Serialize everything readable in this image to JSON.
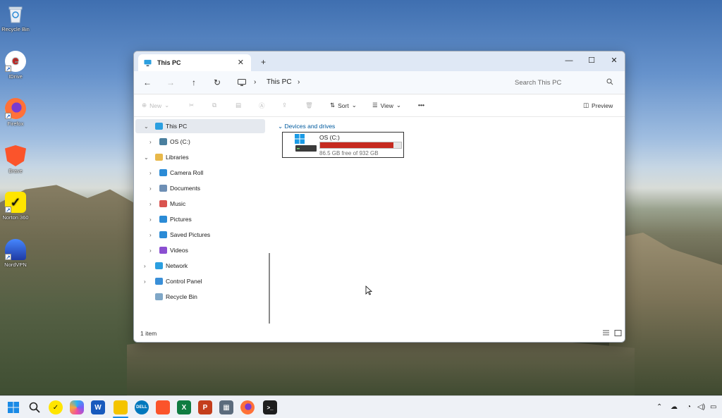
{
  "desktop": {
    "icons": [
      {
        "label": "Recycle Bin",
        "icon": "recycle-bin-icon"
      },
      {
        "label": "IDrive",
        "icon": "idrive-icon"
      },
      {
        "label": "Firefox",
        "icon": "firefox-icon"
      },
      {
        "label": "Brave",
        "icon": "brave-icon"
      },
      {
        "label": "Norton 360",
        "icon": "norton-icon"
      },
      {
        "label": "NordVPN",
        "icon": "nordvpn-icon"
      }
    ]
  },
  "window": {
    "tab_title": "This PC",
    "tab_close": "✕",
    "new_tab": "+",
    "controls": {
      "minimize": "—",
      "maximize": "☐",
      "close": "✕"
    },
    "breadcrumb": {
      "location": "This PC",
      "separator": "›"
    },
    "search_placeholder": "Search This PC",
    "commands": {
      "new": "New",
      "sort": "Sort",
      "view": "View",
      "more": "•••",
      "preview": "Preview"
    },
    "nav_pane": [
      {
        "label": "This PC",
        "icon": "this-pc-icon",
        "selected": true,
        "expanded": true
      },
      {
        "label": "OS (C:)",
        "icon": "drive-icon"
      },
      {
        "label": "Libraries",
        "icon": "libraries-icon",
        "expanded": true
      },
      {
        "label": "Camera Roll",
        "icon": "camera-roll-icon"
      },
      {
        "label": "Documents",
        "icon": "documents-icon"
      },
      {
        "label": "Music",
        "icon": "music-icon"
      },
      {
        "label": "Pictures",
        "icon": "pictures-icon"
      },
      {
        "label": "Saved Pictures",
        "icon": "saved-pictures-icon"
      },
      {
        "label": "Videos",
        "icon": "videos-icon"
      },
      {
        "label": "Network",
        "icon": "network-icon"
      },
      {
        "label": "Control Panel",
        "icon": "control-panel-icon"
      },
      {
        "label": "Recycle Bin",
        "icon": "recycle-bin-icon"
      }
    ],
    "content": {
      "group_label": "Devices and drives",
      "drive": {
        "name": "OS (C:)",
        "free_text": "86.5 GB free of 932 GB",
        "used_fraction": 0.907,
        "bar_color": "#c62a1f"
      }
    },
    "status": {
      "item_count": "1 item"
    }
  },
  "taskbar": {
    "apps": [
      "start",
      "search",
      "norton",
      "copilot",
      "word",
      "file-explorer",
      "dell",
      "brave",
      "excel",
      "powerpoint",
      "calculator",
      "firefox",
      "terminal"
    ]
  },
  "accent": "#005a9e"
}
